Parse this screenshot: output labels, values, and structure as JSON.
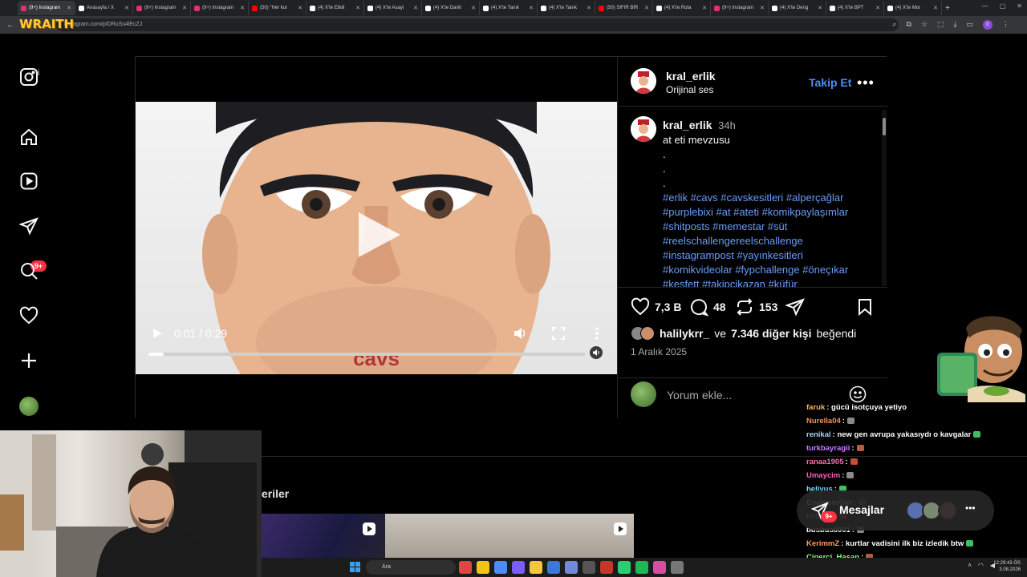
{
  "browser": {
    "tabs": [
      {
        "label": "(9+) Instagram",
        "color": "#e1306c",
        "active": true
      },
      {
        "label": "Anasayfa / X",
        "color": "#ffffff",
        "active": false
      },
      {
        "label": "(9+) Instagram",
        "color": "#e1306c",
        "active": false
      },
      {
        "label": "(9+) Instagram",
        "color": "#e1306c",
        "active": false
      },
      {
        "label": "(50) \"Her kur",
        "color": "#ff0000",
        "active": false
      },
      {
        "label": "(4) X'te Etkili",
        "color": "#ffffff",
        "active": false
      },
      {
        "label": "(4) X'te Asayi",
        "color": "#ffffff",
        "active": false
      },
      {
        "label": "(4) X'te Darkl",
        "color": "#ffffff",
        "active": false
      },
      {
        "label": "(4) X'te Tanık",
        "color": "#ffffff",
        "active": false
      },
      {
        "label": "(4) X'te Tanık",
        "color": "#ffffff",
        "active": false
      },
      {
        "label": "(50) SIFIR BİR",
        "color": "#ff0000",
        "active": false
      },
      {
        "label": "(4) X'te Rota",
        "color": "#ffffff",
        "active": false
      },
      {
        "label": "(9+) Instagram",
        "color": "#e1306c",
        "active": false
      },
      {
        "label": "(4) X'te Deng",
        "color": "#ffffff",
        "active": false
      },
      {
        "label": "(4) X'te BPT",
        "color": "#ffffff",
        "active": false
      },
      {
        "label": "(4) X'te Mor",
        "color": "#ffffff",
        "active": false
      }
    ],
    "url": "instagram.com/p/DRuSs4lEcZJ",
    "overlay_logo": "WRAITH"
  },
  "nav": {
    "badge": "9+"
  },
  "video": {
    "caption_text": "cavs",
    "time": "0:01 / 0:29",
    "progress": 0.0345
  },
  "post": {
    "username": "kral_erlik",
    "audio": "Orijinal ses",
    "follow_label": "Takip Et",
    "more_label": "•••",
    "caption_user": "kral_erlik",
    "caption_time": "34h",
    "caption_text": "at eti mevzusu",
    "caption_dots": [
      ".",
      ".",
      "."
    ],
    "hashtags": "#erlik #cavs #cavskesitleri #alperçağlar #purplebixi #at #ateti #komikpaylaşımlar #shitposts #memestar #süt #reelschallengereelschallenge #instagrampost #yayınkesitleri #komikvideolar #fypchallenge #öneçıkar #keşfett #takipcikazan #küfür",
    "likes": "7,3 B",
    "comments": "48",
    "reposts": "153",
    "liked_by_user": "halilykrr_",
    "liked_by_rest_pre": "ve",
    "liked_by_rest": "7.346 diğer kişi",
    "liked_by_suffix": "beğendi",
    "date": "1 Aralık 2025",
    "comment_placeholder": "Yorum ekle..."
  },
  "below": {
    "more_posts_label": "eriler"
  },
  "chat": {
    "messages": [
      {
        "user": "faruk",
        "color": "#ffb347",
        "text": ": gücü isotçuya yetiyo"
      },
      {
        "user": "Nurella04",
        "color": "#ff8c5a",
        "text": ":"
      },
      {
        "user": "renikal",
        "color": "#9fd7ff",
        "text": ": new gen avrupa yakasıydı o kavgalar"
      },
      {
        "user": "turkbayragii",
        "color": "#c77dff",
        "text": ":"
      },
      {
        "user": "ranaa1905",
        "color": "#ff6fae",
        "text": ":"
      },
      {
        "user": "Umaycim",
        "color": "#ff5ec4",
        "text": ":"
      },
      {
        "user": "heliyus",
        "color": "#7fd6ff",
        "text": ":"
      },
      {
        "user": "EngineerGirl",
        "color": "#ffffff",
        "text": ":"
      },
      {
        "user": "heliyus",
        "color": "#7fd6ff",
        "text": ":"
      },
      {
        "user": "busbus8901",
        "color": "#ffffff",
        "text": ":"
      },
      {
        "user": "KerimmZ",
        "color": "#ff9966",
        "text": ": kurtlar vadisini ilk biz izledik btw"
      },
      {
        "user": "Cigerci_Hasan",
        "color": "#8cff8c",
        "text": ":"
      }
    ],
    "messages_label": "Mesajlar",
    "messages_badge": "9+"
  },
  "taskbar": {
    "search_placeholder": "Ara",
    "clock_time": "12:29:43 ÖS",
    "clock_date": "3.08.2026"
  }
}
